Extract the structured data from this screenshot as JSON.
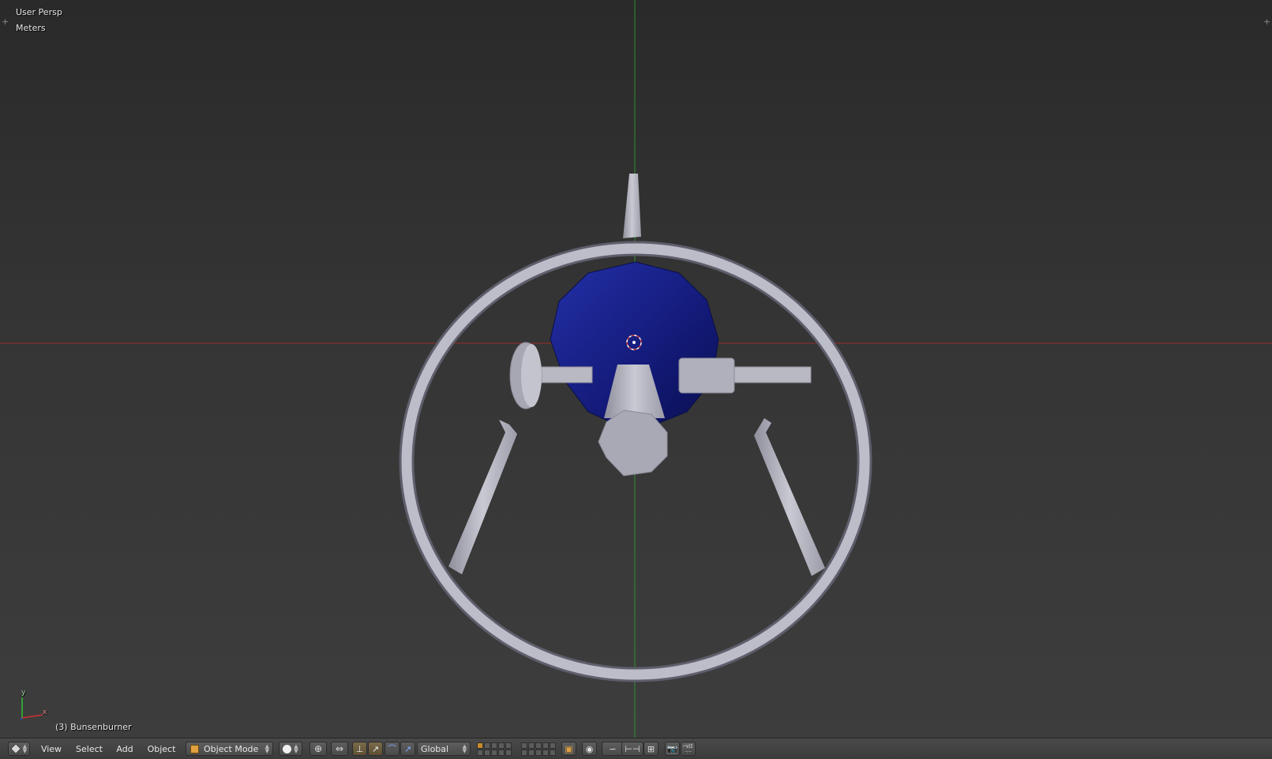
{
  "viewport": {
    "view_name": "User Persp",
    "units": "Meters",
    "active_object": "(3) Bunsenburner",
    "axis_x_label": "x",
    "axis_y_label": "y",
    "colors": {
      "background": "#393939",
      "x_axis_line": "#9b2b2b",
      "y_axis_line": "#2f8f2f",
      "ring": "#b4b4c2",
      "burner_base": "#131a78"
    }
  },
  "header": {
    "editor_type_icon": "cube-icon",
    "menus": [
      "View",
      "Select",
      "Add",
      "Object"
    ],
    "mode": "Object Mode",
    "mode_icon": "object-mode-cube-icon",
    "shading_icon": "solid-sphere-icon",
    "pivot_icon": "pivot-point-icon",
    "manipulator_icon": "manipulator-icon",
    "transform_orientation": "Global",
    "icons": [
      "translate-icon",
      "rotate-icon",
      "scale-icon",
      "layer-icon",
      "proportional-edit-icon",
      "snap-icon",
      "snap-target-icon",
      "render-icon",
      "clapper-icon"
    ]
  }
}
